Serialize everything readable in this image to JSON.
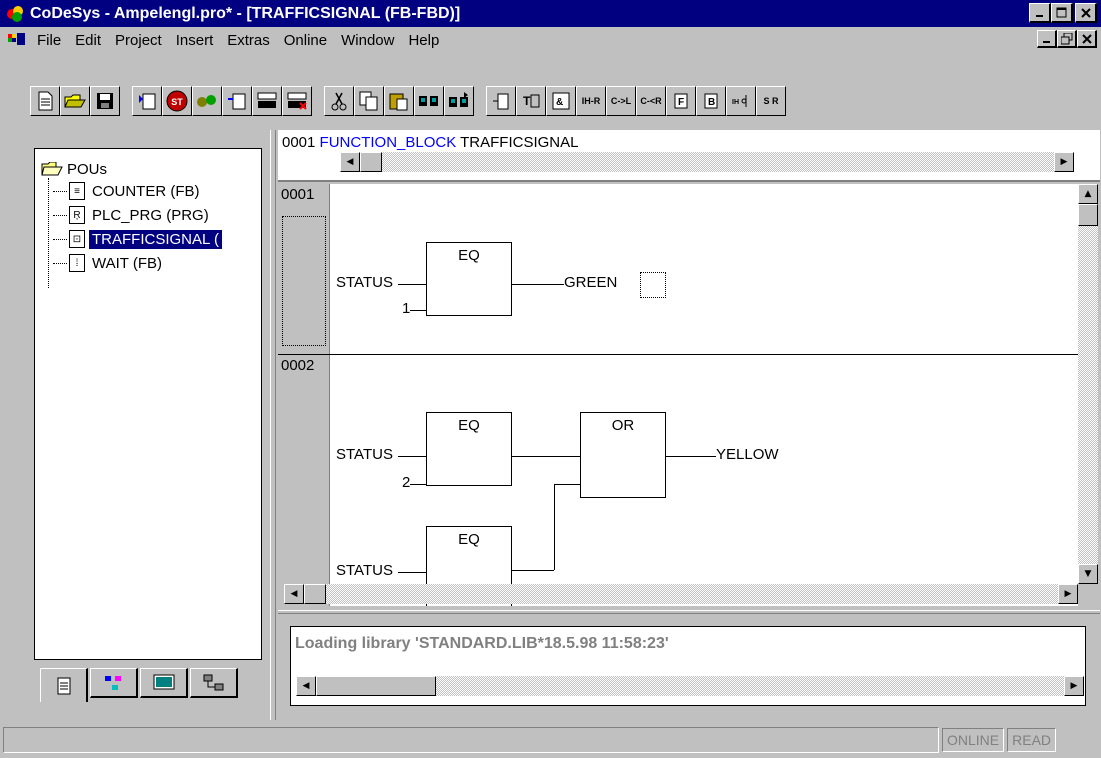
{
  "title": "CoDeSys - Ampelengl.pro* - [TRAFFICSIGNAL (FB-FBD)]",
  "menu": [
    {
      "label": "File"
    },
    {
      "label": "Edit"
    },
    {
      "label": "Project"
    },
    {
      "label": "Insert"
    },
    {
      "label": "Extras"
    },
    {
      "label": "Online"
    },
    {
      "label": "Window"
    },
    {
      "label": "Help"
    }
  ],
  "toolbar": {
    "groups": [
      [
        "new-icon",
        "open-icon",
        "save-icon"
      ],
      [
        "login-icon",
        "stop-icon",
        "run-icon",
        "breakpoint-icon",
        "step-over-icon",
        "step-in-icon"
      ],
      [
        "cut-icon",
        "copy-icon",
        "paste-icon",
        "find-icon",
        "find-next-icon"
      ],
      [
        "network-before-icon",
        "box-icon",
        "input-icon",
        "output-icon",
        "jump-icon",
        "return-icon",
        "assign-icon",
        "comment-icon",
        "negate-icon",
        "set-reset-icon"
      ]
    ],
    "fbd_labels": {
      "ht1": "IH-R",
      "ht2": "C->L",
      "ht3": "C-<R",
      "sr": "S R"
    }
  },
  "tree": {
    "root": "POUs",
    "items": [
      {
        "label": "COUNTER (FB)",
        "icon": "fb-doc-icon",
        "selected": false
      },
      {
        "label": "PLC_PRG (PRG)",
        "icon": "prg-doc-icon",
        "selected": false
      },
      {
        "label": "TRAFFICSIGNAL (",
        "icon": "fbd-doc-icon",
        "selected": true
      },
      {
        "label": "WAIT (FB)",
        "icon": "fb-doc-icon",
        "selected": false
      }
    ]
  },
  "declaration": {
    "line_number": "0001",
    "keyword": "FUNCTION_BLOCK",
    "name": "TRAFFICSIGNAL"
  },
  "networks": [
    {
      "number": "0001",
      "blocks": [
        {
          "label": "EQ",
          "inputs": [
            "STATUS",
            "1"
          ]
        }
      ],
      "output": "GREEN"
    },
    {
      "number": "0002",
      "blocks": [
        {
          "label": "EQ",
          "inputs": [
            "STATUS",
            "2"
          ]
        },
        {
          "label": "OR"
        },
        {
          "label": "EQ",
          "inputs": [
            "STATUS"
          ]
        }
      ],
      "output": "YELLOW"
    }
  ],
  "message": "Loading library 'STANDARD.LIB*18.5.98 11:58:23'",
  "status": {
    "online": "ONLINE",
    "read": "READ"
  },
  "colors": {
    "titlebar": "#000080",
    "keyword": "#0000ff",
    "selection": "#000080"
  }
}
